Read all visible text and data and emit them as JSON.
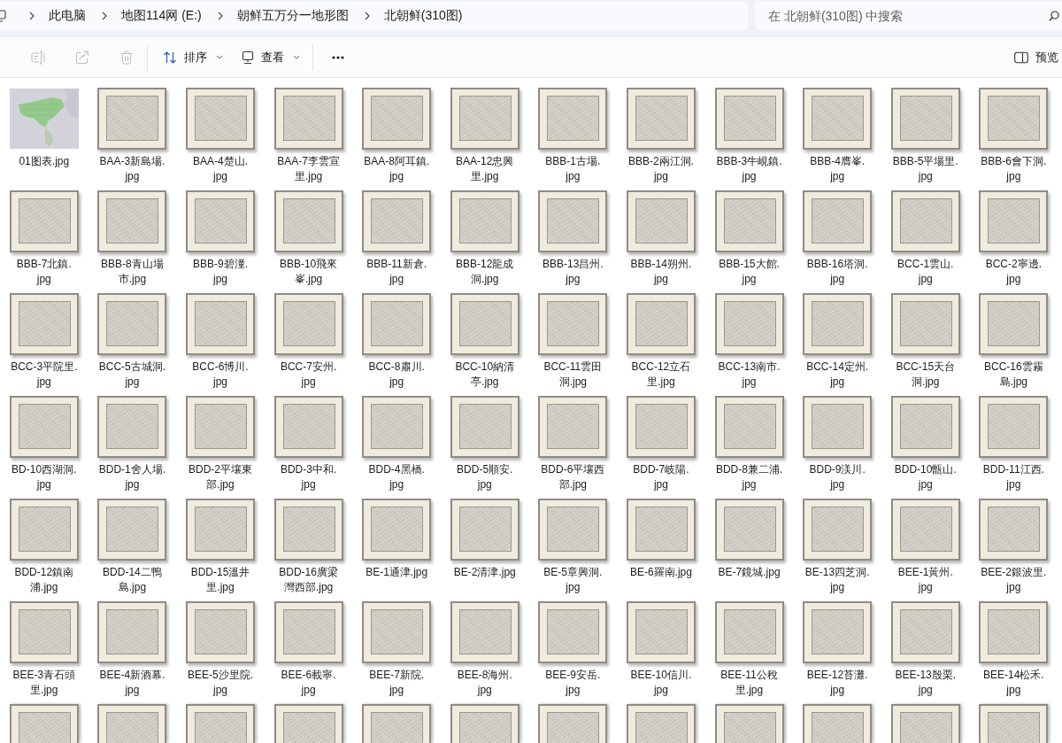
{
  "address_bar": {
    "path": [
      {
        "label": "此电脑"
      },
      {
        "label": "地图114网 (E:)"
      },
      {
        "label": "朝鲜五万分一地形图"
      },
      {
        "label": "北朝鲜(310图)"
      }
    ]
  },
  "search": {
    "placeholder": "在 北朝鲜(310图) 中搜索"
  },
  "toolbar": {
    "actions": [
      {
        "kind": "rename",
        "disabled": true
      },
      {
        "kind": "share",
        "disabled": true
      },
      {
        "kind": "delete",
        "disabled": true
      }
    ],
    "menus": [
      {
        "kind": "sort",
        "label": "排序"
      },
      {
        "kind": "view",
        "label": "查看"
      }
    ],
    "preview": {
      "label": "预览"
    }
  },
  "files": [
    {
      "name": "01图表.jpg",
      "kind": "index"
    },
    {
      "name": "BAA-3新島場.jpg",
      "kind": "map"
    },
    {
      "name": "BAA-4楚山.jpg",
      "kind": "map"
    },
    {
      "name": "BAA-7李雲宣里.jpg",
      "kind": "map"
    },
    {
      "name": "BAA-8阿耳鎮.jpg",
      "kind": "map"
    },
    {
      "name": "BAA-12忠興里.jpg",
      "kind": "map"
    },
    {
      "name": "BBB-1古場.jpg",
      "kind": "map"
    },
    {
      "name": "BBB-2兩江洞.jpg",
      "kind": "map"
    },
    {
      "name": "BBB-3牛峴鎮.jpg",
      "kind": "map"
    },
    {
      "name": "BBB-4膺峯.jpg",
      "kind": "map"
    },
    {
      "name": "BBB-5平場里.jpg",
      "kind": "map"
    },
    {
      "name": "BBB-6會下洞.jpg",
      "kind": "map"
    },
    {
      "name": "BBB-7北鎮.jpg",
      "kind": "map"
    },
    {
      "name": "BBB-8青山場市.jpg",
      "kind": "map"
    },
    {
      "name": "BBB-9碧潼.jpg",
      "kind": "map"
    },
    {
      "name": "BBB-10飛來峯.jpg",
      "kind": "map"
    },
    {
      "name": "BBB-11新倉.jpg",
      "kind": "map"
    },
    {
      "name": "BBB-12龍成洞.jpg",
      "kind": "map"
    },
    {
      "name": "BBB-13昌州.jpg",
      "kind": "map"
    },
    {
      "name": "BBB-14朔州.jpg",
      "kind": "map"
    },
    {
      "name": "BBB-15大館.jpg",
      "kind": "map"
    },
    {
      "name": "BBB-16塔洞.jpg",
      "kind": "map"
    },
    {
      "name": "BCC-1雲山.jpg",
      "kind": "map"
    },
    {
      "name": "BCC-2寧邊.jpg",
      "kind": "map"
    },
    {
      "name": "BCC-3平院里.jpg",
      "kind": "map"
    },
    {
      "name": "BCC-5古城洞.jpg",
      "kind": "map"
    },
    {
      "name": "BCC-6博川.jpg",
      "kind": "map"
    },
    {
      "name": "BCC-7安州.jpg",
      "kind": "map"
    },
    {
      "name": "BCC-8肅川.jpg",
      "kind": "map"
    },
    {
      "name": "BCC-10納清亭.jpg",
      "kind": "map"
    },
    {
      "name": "BCC-11雲田洞.jpg",
      "kind": "map"
    },
    {
      "name": "BCC-12立石里.jpg",
      "kind": "map"
    },
    {
      "name": "BCC-13南市.jpg",
      "kind": "map"
    },
    {
      "name": "BCC-14定州.jpg",
      "kind": "map"
    },
    {
      "name": "BCC-15天台洞.jpg",
      "kind": "map"
    },
    {
      "name": "BCC-16雲霧島.jpg",
      "kind": "map"
    },
    {
      "name": "BD-10西湖洞.jpg",
      "kind": "map"
    },
    {
      "name": "BDD-1舍人場.jpg",
      "kind": "map"
    },
    {
      "name": "BDD-2平壤東部.jpg",
      "kind": "map"
    },
    {
      "name": "BDD-3中和.jpg",
      "kind": "map"
    },
    {
      "name": "BDD-4黑橋.jpg",
      "kind": "map"
    },
    {
      "name": "BDD-5順安.jpg",
      "kind": "map"
    },
    {
      "name": "BDD-6平壤西部.jpg",
      "kind": "map"
    },
    {
      "name": "BDD-7岐陽.jpg",
      "kind": "map"
    },
    {
      "name": "BDD-8兼二浦.jpg",
      "kind": "map"
    },
    {
      "name": "BDD-9渼川.jpg",
      "kind": "map"
    },
    {
      "name": "BDD-10甑山.jpg",
      "kind": "map"
    },
    {
      "name": "BDD-11江西.jpg",
      "kind": "map"
    },
    {
      "name": "BDD-12鎮南浦.jpg",
      "kind": "map"
    },
    {
      "name": "BDD-14二鴨島.jpg",
      "kind": "map"
    },
    {
      "name": "BDD-15溫井里.jpg",
      "kind": "map"
    },
    {
      "name": "BDD-16廣梁灣西部.jpg",
      "kind": "map"
    },
    {
      "name": "BE-1通津.jpg",
      "kind": "map"
    },
    {
      "name": "BE-2清津.jpg",
      "kind": "map"
    },
    {
      "name": "BE-5章興洞.jpg",
      "kind": "map"
    },
    {
      "name": "BE-6羅南.jpg",
      "kind": "map"
    },
    {
      "name": "BE-7鏡城.jpg",
      "kind": "map"
    },
    {
      "name": "BE-13四芝洞.jpg",
      "kind": "map"
    },
    {
      "name": "BEE-1黃州.jpg",
      "kind": "map"
    },
    {
      "name": "BEE-2銀波里.jpg",
      "kind": "map"
    },
    {
      "name": "BEE-3青石頭里.jpg",
      "kind": "map"
    },
    {
      "name": "BEE-4新酒幕.jpg",
      "kind": "map"
    },
    {
      "name": "BEE-5沙里院.jpg",
      "kind": "map"
    },
    {
      "name": "BEE-6載寧.jpg",
      "kind": "map"
    },
    {
      "name": "BEE-7新院.jpg",
      "kind": "map"
    },
    {
      "name": "BEE-8海州.jpg",
      "kind": "map"
    },
    {
      "name": "BEE-9安岳.jpg",
      "kind": "map"
    },
    {
      "name": "BEE-10信川.jpg",
      "kind": "map"
    },
    {
      "name": "BEE-11公稅里.jpg",
      "kind": "map"
    },
    {
      "name": "BEE-12苔灘.jpg",
      "kind": "map"
    },
    {
      "name": "BEE-13殷栗.jpg",
      "kind": "map"
    },
    {
      "name": "BEE-14松禾.jpg",
      "kind": "map"
    }
  ],
  "partial_row": [
    {
      "kind": "map"
    },
    {
      "kind": "map"
    },
    {
      "kind": "map"
    },
    {
      "kind": "map"
    },
    {
      "kind": "map"
    },
    {
      "kind": "map"
    },
    {
      "kind": "map"
    },
    {
      "kind": "map"
    },
    {
      "kind": "map"
    },
    {
      "kind": "map"
    },
    {
      "kind": "map"
    },
    {
      "kind": "map"
    }
  ]
}
